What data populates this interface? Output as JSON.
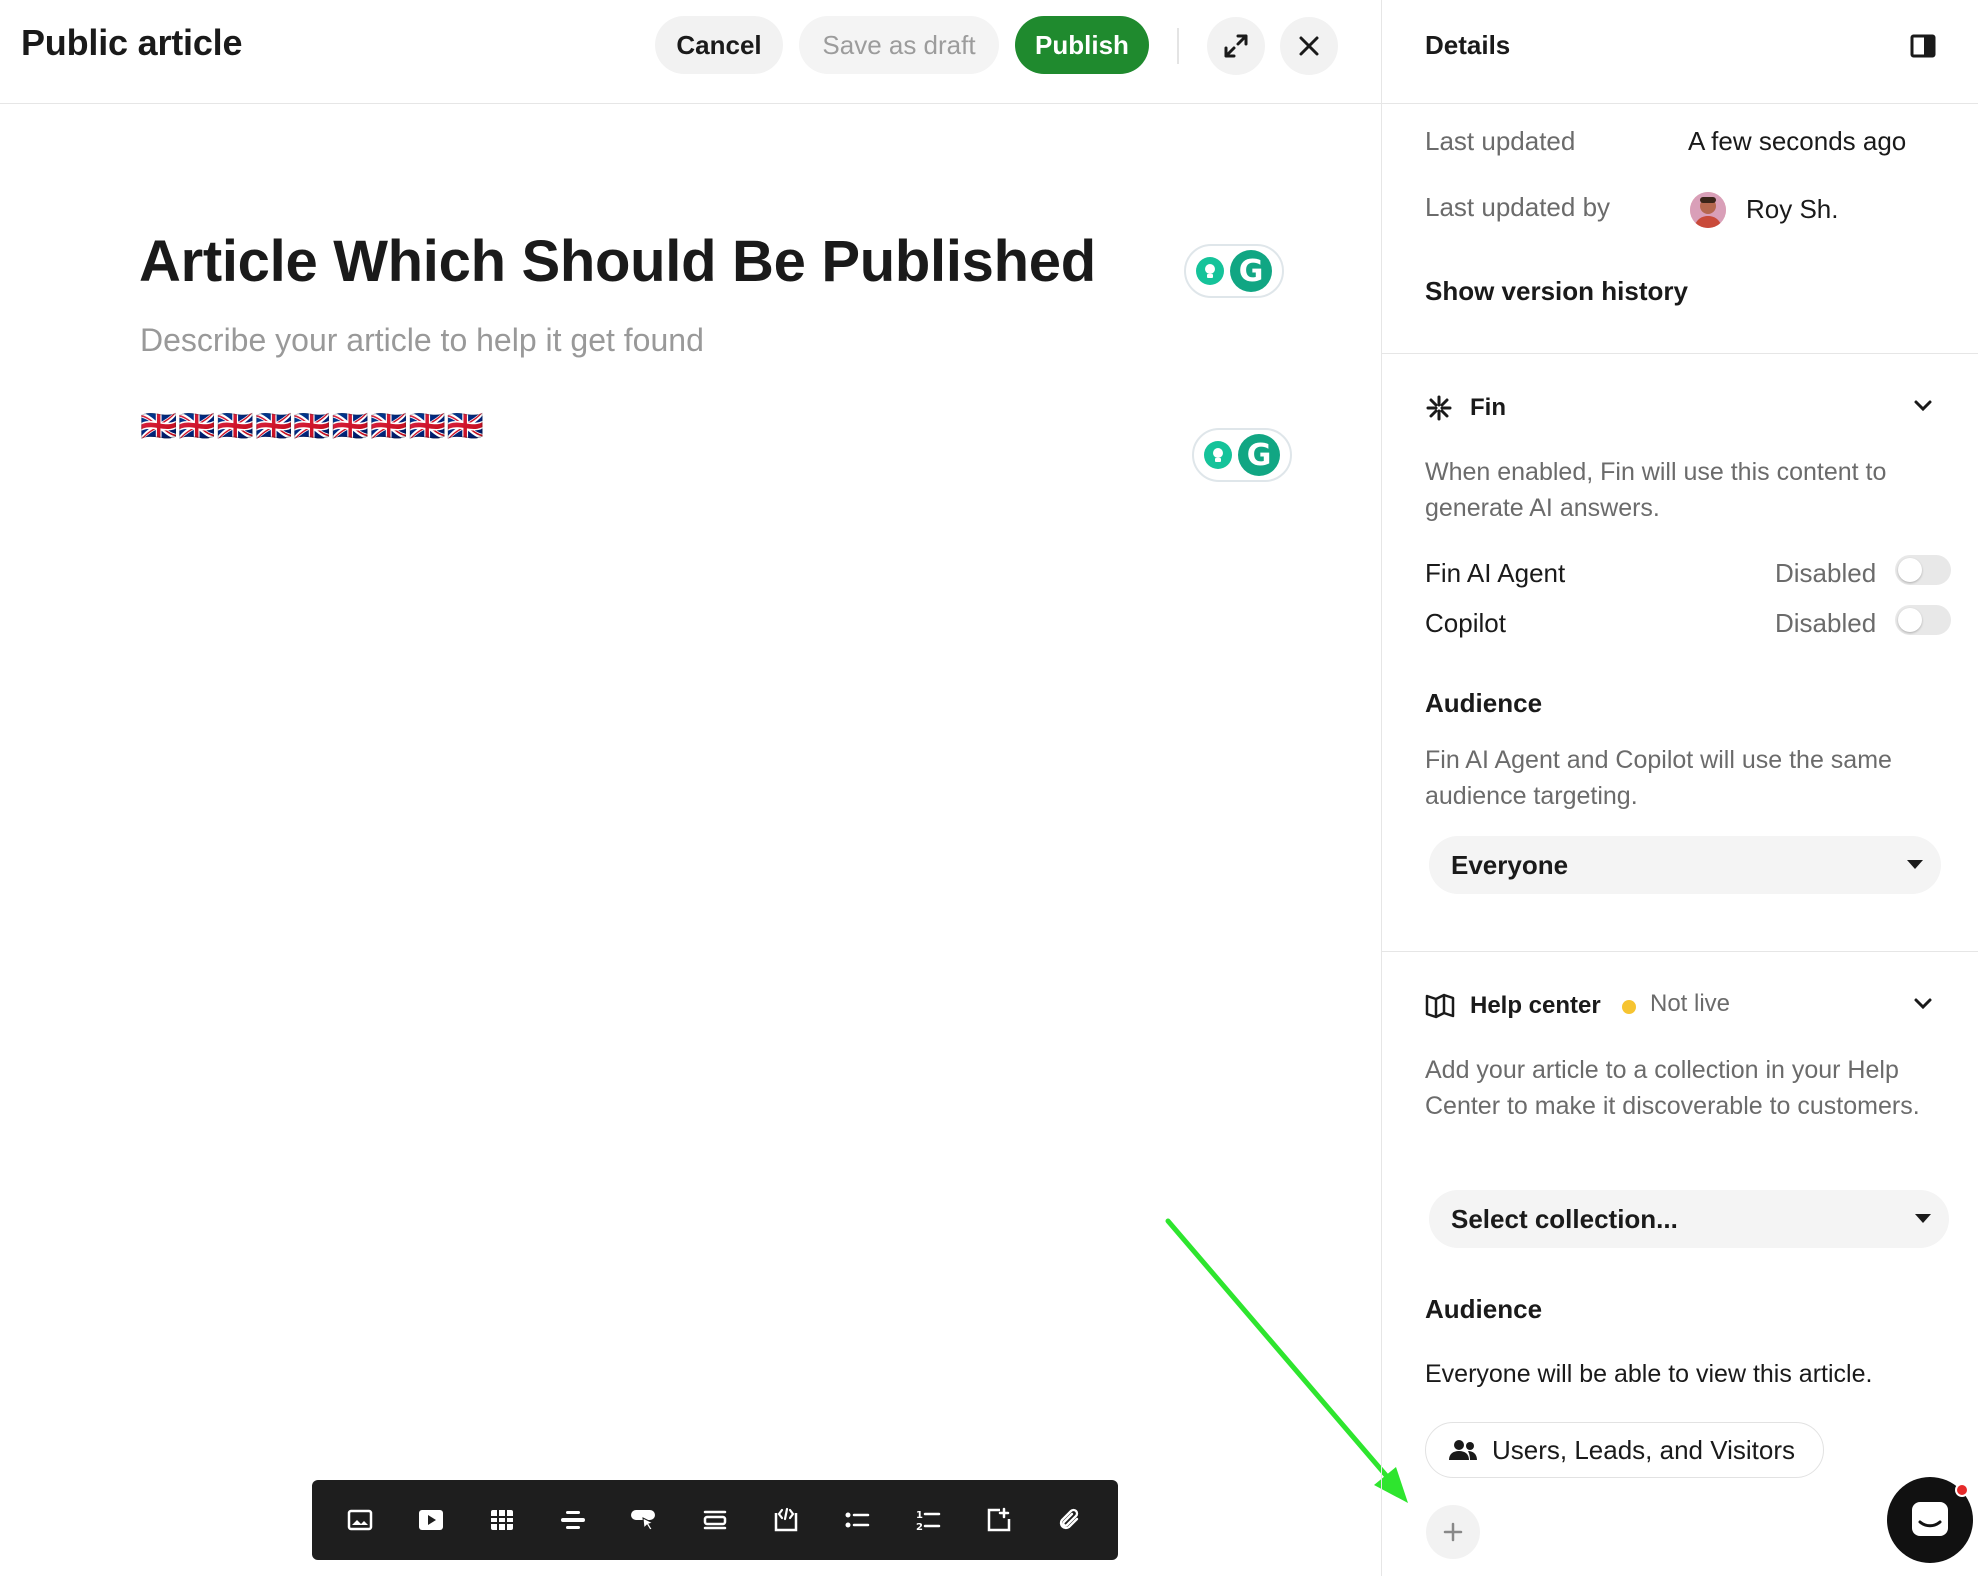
{
  "header": {
    "title": "Public article",
    "cancel_label": "Cancel",
    "draft_label": "Save as draft",
    "publish_label": "Publish",
    "publish_color": "#1f8a2e",
    "expand_icon": "expand-icon",
    "close_icon": "close-icon"
  },
  "editor": {
    "title": "Article Which Should Be Published",
    "description_placeholder": "Describe your article to help it get found",
    "body_flags": "🇬🇧🇬🇧🇬🇧🇬🇧🇬🇧🇬🇧🇬🇧🇬🇧🇬🇧",
    "grammarly_letter": "G",
    "toolbar": [
      "image-icon",
      "video-icon",
      "table-icon",
      "divider-icon",
      "button-icon",
      "callout-icon",
      "code-icon",
      "bullet-list-icon",
      "numbered-list-icon",
      "collapsible-icon",
      "attachment-icon"
    ]
  },
  "details": {
    "title": "Details",
    "last_updated_label": "Last updated",
    "last_updated_value": "A few seconds ago",
    "last_updated_by_label": "Last updated by",
    "last_updated_by_value": "Roy Sh.",
    "show_version_history": "Show version history"
  },
  "fin": {
    "title": "Fin",
    "description": "When enabled, Fin will use this content to generate AI answers.",
    "agent_label": "Fin AI Agent",
    "agent_state": "Disabled",
    "copilot_label": "Copilot",
    "copilot_state": "Disabled",
    "audience_title": "Audience",
    "audience_description": "Fin AI Agent and Copilot will use the same audience targeting.",
    "audience_value": "Everyone"
  },
  "help_center": {
    "title": "Help center",
    "status": "Not live",
    "status_color": "#f6c431",
    "description": "Add your article to a collection in your Help Center to make it discoverable to customers.",
    "collection_placeholder": "Select collection...",
    "audience_title": "Audience",
    "audience_description": "Everyone will be able to view this article.",
    "audience_chip": "Users, Leads, and Visitors"
  }
}
